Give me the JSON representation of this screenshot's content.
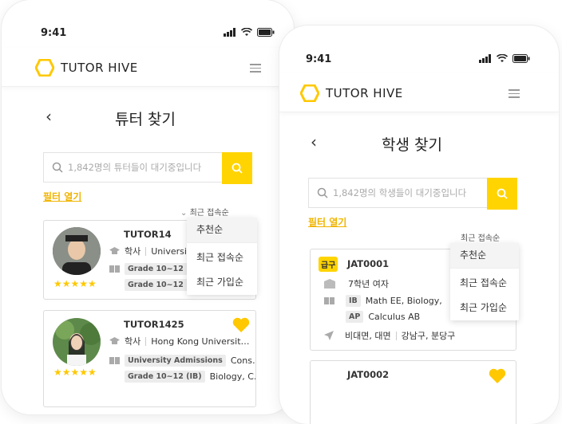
{
  "status": {
    "time": "9:41"
  },
  "brand": {
    "name": "TUTOR HIVE",
    "accent": "#ffd400",
    "link_color": "#f0b400"
  },
  "left": {
    "title": "튜터 찾기",
    "search_placeholder": "1,842명의 튜터들이 대기중입니다",
    "filter_label": "필터 열기",
    "sort_label": "최근 접속순",
    "sort_options": [
      "추천순",
      "최근 접속순",
      "최근 가입순"
    ],
    "tutors": [
      {
        "name": "TUTOR14",
        "degree": "학사",
        "school": "University",
        "chips": [
          "Grade 10~12 (IGC",
          "Grade 10~12 (IB)"
        ],
        "rating": 5
      },
      {
        "name": "TUTOR1425",
        "degree": "학사",
        "school": "Hong Kong Universit…",
        "chips": [
          "University Admissions",
          "Grade 10~12 (IB)"
        ],
        "chip_texts": [
          "Cons…",
          "Biology, C…"
        ],
        "rating": 5
      }
    ]
  },
  "right": {
    "title": "학생 찾기",
    "search_placeholder": "1,842명의 학생들이 대기중입니다",
    "filter_label": "필터 열기",
    "sort_label": "최근 접속순",
    "sort_options": [
      "추천순",
      "최근 접속순",
      "최근 가입순"
    ],
    "students": [
      {
        "badge": "급구",
        "id": "JAT0001",
        "grade": "7학년 여자",
        "ib_chip": "IB",
        "ib_text": "Math EE, Biology,",
        "ap_chip": "AP",
        "ap_text": "Calculus AB",
        "mode": "비대면, 대면",
        "region": "강남구, 분당구"
      },
      {
        "id": "JAT0002"
      }
    ]
  }
}
